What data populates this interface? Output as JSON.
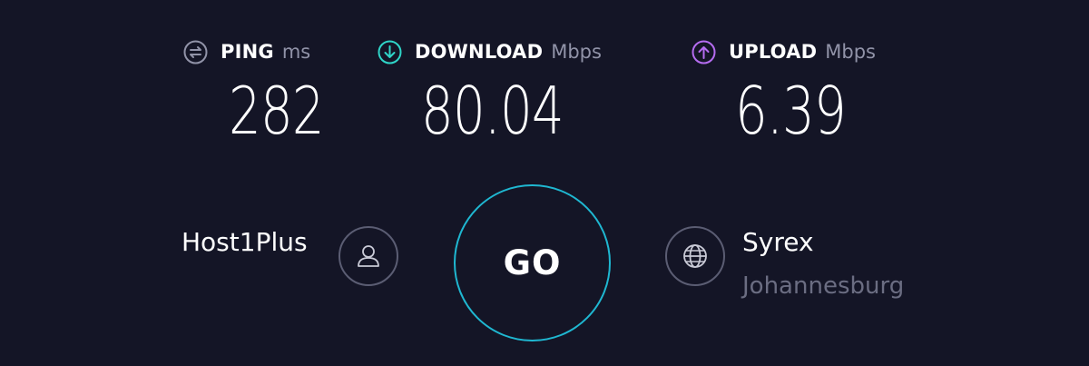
{
  "metrics": {
    "ping": {
      "label": "PING",
      "unit": "ms",
      "value": "282",
      "icon": "ping-icon",
      "icon_color": "#9193a8"
    },
    "download": {
      "label": "DOWNLOAD",
      "unit": "Mbps",
      "value": "80.04",
      "icon": "download-arrow-icon",
      "icon_color": "#2fd5c8"
    },
    "upload": {
      "label": "UPLOAD",
      "unit": "Mbps",
      "value": "6.39",
      "icon": "upload-arrow-icon",
      "icon_color": "#b56cf0"
    }
  },
  "provider": {
    "name": "Host1Plus",
    "icon": "user-icon"
  },
  "go_button": {
    "label": "GO",
    "ring_color": "#1fb7d1"
  },
  "server": {
    "name": "Syrex",
    "location": "Johannesburg",
    "icon": "globe-icon"
  },
  "colors": {
    "background": "#141526",
    "text": "#ffffff",
    "muted": "#9193a8"
  }
}
